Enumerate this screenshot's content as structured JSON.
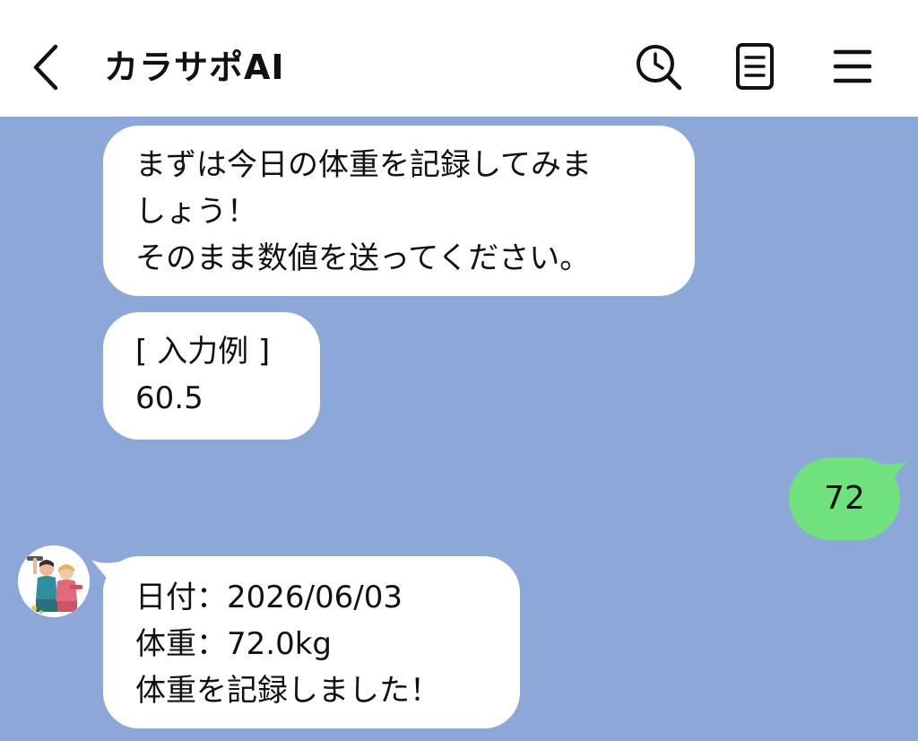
{
  "header": {
    "title": "カラサポAI",
    "back_icon": "chevron-left-icon",
    "search_icon": "search-clock-icon",
    "notes_icon": "notes-icon",
    "menu_icon": "hamburger-menu-icon"
  },
  "messages": [
    {
      "side": "received",
      "lines": [
        "まずは今日の体重を記録してみま",
        "しょう！",
        "そのまま数値を送ってください。"
      ]
    },
    {
      "side": "received",
      "lines": [
        "[ 入力例 ]",
        "60.5"
      ]
    },
    {
      "side": "sent",
      "lines": [
        "72"
      ]
    },
    {
      "side": "received",
      "lines": [
        "日付：2026/06/03",
        "体重：72.0kg",
        "体重を記録しました！"
      ]
    }
  ],
  "colors": {
    "chat_background": "#8ca8d8",
    "sent_bubble": "#6fe17d",
    "received_bubble": "#ffffff",
    "header_background": "#ffffff"
  }
}
